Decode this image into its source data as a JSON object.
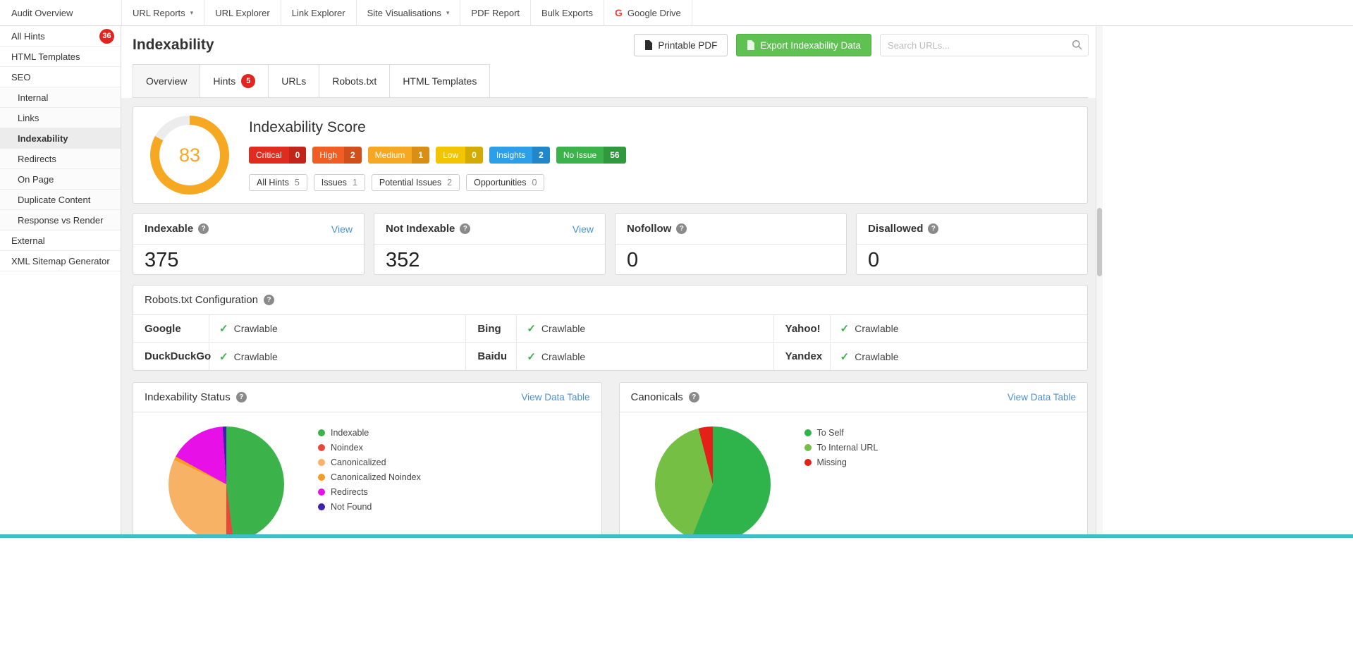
{
  "navbar": {
    "brand": "Audit Overview",
    "items": [
      {
        "label": "URL Reports",
        "dropdown": true
      },
      {
        "label": "URL Explorer"
      },
      {
        "label": "Link Explorer"
      },
      {
        "label": "Site Visualisations",
        "dropdown": true
      },
      {
        "label": "PDF Report"
      },
      {
        "label": "Bulk Exports"
      },
      {
        "label": "Google Drive",
        "icon": "google-logo"
      }
    ]
  },
  "sidebar": {
    "items": [
      {
        "label": "All Hints",
        "badge": "36"
      },
      {
        "label": "HTML Templates"
      },
      {
        "label": "SEO"
      },
      {
        "label": "Internal"
      },
      {
        "label": "Links"
      },
      {
        "label": "Indexability",
        "active": true
      },
      {
        "label": "Redirects"
      },
      {
        "label": "On Page"
      },
      {
        "label": "Duplicate Content"
      },
      {
        "label": "Response vs Render"
      },
      {
        "label": "External"
      },
      {
        "label": "XML Sitemap Generator"
      }
    ]
  },
  "header": {
    "title": "Indexability",
    "printable_pdf_label": "Printable PDF",
    "export_label": "Export Indexability Data",
    "export_color": "#5fc152",
    "search_placeholder": "Search URLs..."
  },
  "tabs": [
    {
      "label": "Overview",
      "active": true
    },
    {
      "label": "Hints",
      "badge": "5"
    },
    {
      "label": "URLs"
    },
    {
      "label": "Robots.txt"
    },
    {
      "label": "HTML Templates"
    }
  ],
  "score_card": {
    "title": "Indexability Score",
    "score": "83",
    "ring_color": "#f7a823",
    "ring_track_color": "#ececec",
    "severity_badges": [
      {
        "label": "Critical",
        "count": "0",
        "color": "#df2c1f",
        "count_color": "#c1251a"
      },
      {
        "label": "High",
        "count": "2",
        "color": "#f05e23",
        "count_color": "#d14f1b"
      },
      {
        "label": "Medium",
        "count": "1",
        "color": "#f7a823",
        "count_color": "#d98f15"
      },
      {
        "label": "Low",
        "count": "0",
        "color": "#f2c500",
        "count_color": "#d3ab02"
      },
      {
        "label": "Insights",
        "count": "2",
        "color": "#2d9fe8",
        "count_color": "#2187c9"
      },
      {
        "label": "No Issue",
        "count": "56",
        "color": "#3cb24a",
        "count_color": "#31993d"
      }
    ],
    "filter_pills": [
      {
        "label": "All Hints",
        "count": "5"
      },
      {
        "label": "Issues",
        "count": "1"
      },
      {
        "label": "Potential Issues",
        "count": "2"
      },
      {
        "label": "Opportunities",
        "count": "0"
      }
    ]
  },
  "stat_cards": [
    {
      "label": "Indexable",
      "value": "375",
      "view_label": "View"
    },
    {
      "label": "Not Indexable",
      "value": "352",
      "view_label": "View"
    },
    {
      "label": "Nofollow",
      "value": "0"
    },
    {
      "label": "Disallowed",
      "value": "0"
    }
  ],
  "robots_card": {
    "title": "Robots.txt Configuration",
    "entries": [
      {
        "engine": "Google",
        "status": "Crawlable"
      },
      {
        "engine": "Bing",
        "status": "Crawlable"
      },
      {
        "engine": "Yahoo!",
        "status": "Crawlable"
      },
      {
        "engine": "DuckDuckGo",
        "status": "Crawlable"
      },
      {
        "engine": "Baidu",
        "status": "Crawlable"
      },
      {
        "engine": "Yandex",
        "status": "Crawlable"
      }
    ]
  },
  "chart_cards": [
    {
      "title": "Indexability Status",
      "link": "View Data Table"
    },
    {
      "title": "Canonicals",
      "link": "View Data Table"
    }
  ],
  "chart_data": [
    {
      "type": "pie",
      "title": "Indexability Status",
      "labels": [
        "Indexable",
        "Noindex",
        "Canonicalized",
        "Canonicalized Noindex",
        "Redirects",
        "Not Found"
      ],
      "values": [
        48,
        2,
        32,
        1,
        16,
        1
      ],
      "values_unit": "percent-estimated",
      "colors": [
        "#3cb24a",
        "#e8493b",
        "#f7b266",
        "#f59d25",
        "#e711e7",
        "#3d22ad"
      ],
      "legend_position": "right"
    },
    {
      "type": "pie",
      "title": "Canonicals",
      "labels": [
        "To Self",
        "To Internal URL",
        "Missing"
      ],
      "values": [
        56,
        40,
        4
      ],
      "values_unit": "percent-estimated",
      "colors": [
        "#2eb44b",
        "#74bf44",
        "#e32119"
      ],
      "legend_position": "right"
    }
  ],
  "colors": {
    "badge_red": "#e2241f",
    "link_blue": "#4a90d2",
    "bottom_bar_teal": "#3ac0ca",
    "content_background": "#f0f0f1"
  }
}
